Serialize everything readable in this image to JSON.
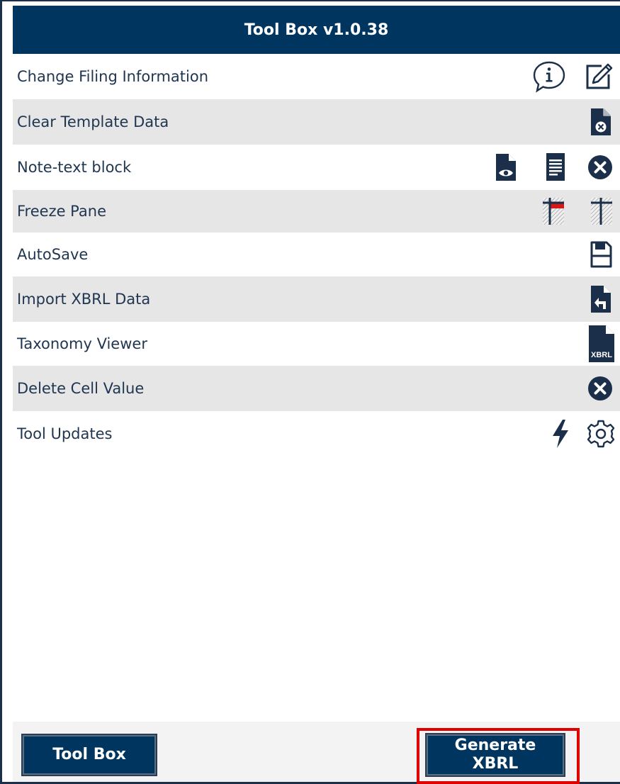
{
  "window": {
    "title": "Tool Box v1.0.38"
  },
  "rows": [
    {
      "label": "Change Filing Information",
      "icons": [
        "info-bubble-icon",
        "edit-icon"
      ]
    },
    {
      "label": "Clear Template Data",
      "icons": [
        "clear-file-icon"
      ]
    },
    {
      "label": "Note-text block",
      "icons": [
        "preview-file-icon",
        "text-document-icon",
        "close-circle-icon"
      ]
    },
    {
      "label": "Freeze Pane",
      "icons": [
        "freeze-pane-icon",
        "unfreeze-pane-icon"
      ]
    },
    {
      "label": "AutoSave",
      "icons": [
        "save-icon"
      ]
    },
    {
      "label": "Import XBRL Data",
      "icons": [
        "import-file-icon"
      ]
    },
    {
      "label": "Taxonomy Viewer",
      "icons": [
        "xbrl-file-icon"
      ]
    },
    {
      "label": "Delete Cell Value",
      "icons": [
        "close-circle-icon"
      ]
    },
    {
      "label": "Tool Updates",
      "icons": [
        "lightning-icon",
        "gear-icon"
      ]
    }
  ],
  "xbrl_icon_text": "XBRL",
  "footer": {
    "toolbox_button": "Tool Box",
    "generate_button_line1": "Generate",
    "generate_button_line2": "XBRL"
  },
  "colors": {
    "header": "#003560",
    "highlight": "#e00000",
    "row_alt": "#e6e6e6",
    "icon": "#1b2f4a"
  }
}
